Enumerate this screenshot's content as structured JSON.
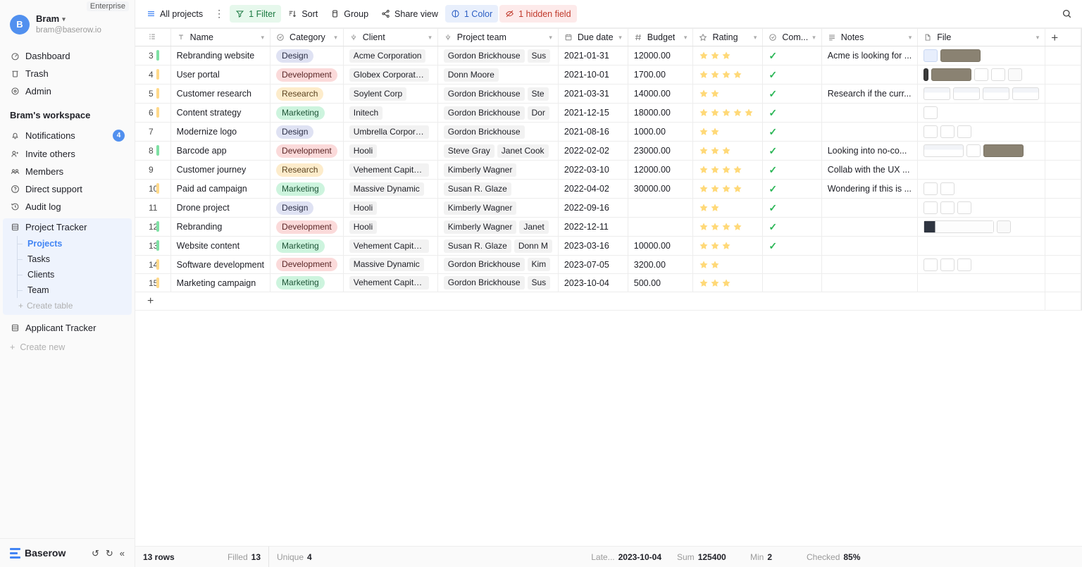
{
  "sidebar": {
    "enterprise_badge": "Enterprise",
    "user": {
      "initial": "B",
      "name": "Bram",
      "email": "bram@baserow.io"
    },
    "nav": [
      {
        "label": "Dashboard",
        "icon": "dashboard-icon"
      },
      {
        "label": "Trash",
        "icon": "trash-icon"
      },
      {
        "label": "Admin",
        "icon": "admin-gear-icon"
      }
    ],
    "workspace_title": "Bram's workspace",
    "workspace_items": [
      {
        "label": "Notifications",
        "icon": "bell-icon",
        "badge": "4"
      },
      {
        "label": "Invite others",
        "icon": "invite-user-icon",
        "badge": ""
      },
      {
        "label": "Members",
        "icon": "members-icon",
        "badge": ""
      },
      {
        "label": "Direct support",
        "icon": "question-circle-icon",
        "badge": ""
      },
      {
        "label": "Audit log",
        "icon": "history-clock-icon",
        "badge": ""
      }
    ],
    "database": {
      "name": "Project Tracker",
      "tables": [
        {
          "label": "Projects",
          "active": true
        },
        {
          "label": "Tasks",
          "active": false
        },
        {
          "label": "Clients",
          "active": false
        },
        {
          "label": "Team",
          "active": false
        }
      ],
      "create_table": "Create table"
    },
    "database2": {
      "name": "Applicant Tracker"
    },
    "create_new": "Create new",
    "footer": {
      "brand": "Baserow",
      "undo": "↺",
      "redo": "↻",
      "collapse": "«"
    }
  },
  "toolbar": {
    "view_name": "All projects",
    "dots": "⋮",
    "filter": "1 Filter",
    "sort": "Sort",
    "group": "Group",
    "share": "Share view",
    "color": "1 Color",
    "hidden_field": "1 hidden field",
    "search_icon": "search-icon"
  },
  "grid": {
    "columns": [
      {
        "key": "rownum",
        "label": "",
        "icon": "rows-icon"
      },
      {
        "key": "name",
        "label": "Name",
        "icon": "text-field-icon"
      },
      {
        "key": "category",
        "label": "Category",
        "icon": "single-select-icon"
      },
      {
        "key": "client",
        "label": "Client",
        "icon": "link-row-icon"
      },
      {
        "key": "team",
        "label": "Project team",
        "icon": "link-row-icon"
      },
      {
        "key": "due",
        "label": "Due date",
        "icon": "calendar-icon"
      },
      {
        "key": "budget",
        "label": "Budget",
        "icon": "number-icon"
      },
      {
        "key": "rating",
        "label": "Rating",
        "icon": "star-icon"
      },
      {
        "key": "com",
        "label": "Com...",
        "icon": "boolean-icon"
      },
      {
        "key": "notes",
        "label": "Notes",
        "icon": "long-text-icon"
      },
      {
        "key": "file",
        "label": "File",
        "icon": "file-icon"
      }
    ],
    "add_field_label": "+",
    "add_row_label": "+",
    "rows": [
      {
        "num": "3",
        "color": "green",
        "name": "Rebranding website",
        "category": "Design",
        "client": "Acme Corporation",
        "team": [
          "Gordon Brickhouse",
          "Sus"
        ],
        "due": "2021-01-31",
        "budget": "12000.00",
        "rating": 3,
        "completed": true,
        "notes": "Acme is looking for ...",
        "files": [
          "blue",
          "photo"
        ]
      },
      {
        "num": "4",
        "color": "yellow",
        "name": "User portal",
        "category": "Development",
        "client": "Globex Corporation",
        "team": [
          "Donn Moore"
        ],
        "due": "2021-10-01",
        "budget": "1700.00",
        "rating": 4,
        "completed": true,
        "notes": "",
        "files": [
          "dark-narrow",
          "photo",
          "icon",
          "icon",
          "white"
        ]
      },
      {
        "num": "5",
        "color": "yellow",
        "name": "Customer research",
        "category": "Research",
        "client": "Soylent Corp",
        "team": [
          "Gordon Brickhouse",
          "Ste"
        ],
        "due": "2021-03-31",
        "budget": "14000.00",
        "rating": 2,
        "completed": true,
        "notes": "Research if the curr...",
        "files": [
          "sheet",
          "sheet",
          "sheet",
          "sheet"
        ]
      },
      {
        "num": "6",
        "color": "yellow",
        "name": "Content strategy",
        "category": "Marketing",
        "client": "Initech",
        "team": [
          "Gordon Brickhouse",
          "Dor"
        ],
        "due": "2021-12-15",
        "budget": "18000.00",
        "rating": 5,
        "completed": true,
        "notes": "",
        "files": [
          "icon"
        ]
      },
      {
        "num": "7",
        "color": "",
        "name": "Modernize logo",
        "category": "Design",
        "client": "Umbrella Corporation",
        "team": [
          "Gordon Brickhouse"
        ],
        "due": "2021-08-16",
        "budget": "1000.00",
        "rating": 2,
        "completed": true,
        "notes": "",
        "files": [
          "icon",
          "icon",
          "icon"
        ]
      },
      {
        "num": "8",
        "color": "green",
        "name": "Barcode app",
        "category": "Development",
        "client": "Hooli",
        "team": [
          "Steve Gray",
          "Janet Cook"
        ],
        "due": "2022-02-02",
        "budget": "23000.00",
        "rating": 3,
        "completed": true,
        "notes": "Looking into no-co...",
        "files": [
          "sheet-wide",
          "icon",
          "photo"
        ]
      },
      {
        "num": "9",
        "color": "",
        "name": "Customer journey",
        "category": "Research",
        "client": "Vehement Capital Pa...",
        "team": [
          "Kimberly Wagner"
        ],
        "due": "2022-03-10",
        "budget": "12000.00",
        "rating": 4,
        "completed": true,
        "notes": "Collab with the UX ...",
        "files": []
      },
      {
        "num": "10",
        "color": "yellow",
        "name": "Paid ad campaign",
        "category": "Marketing",
        "client": "Massive Dynamic",
        "team": [
          "Susan R. Glaze"
        ],
        "due": "2022-04-02",
        "budget": "30000.00",
        "rating": 4,
        "completed": true,
        "notes": "Wondering if this is ...",
        "files": [
          "icon",
          "icon"
        ]
      },
      {
        "num": "11",
        "color": "",
        "name": "Drone project",
        "category": "Design",
        "client": "Hooli",
        "team": [
          "Kimberly Wagner"
        ],
        "due": "2022-09-16",
        "budget": "",
        "rating": 2,
        "completed": true,
        "notes": "",
        "files": [
          "icon",
          "icon",
          "icon"
        ]
      },
      {
        "num": "12",
        "color": "green",
        "name": "Rebranding",
        "category": "Development",
        "client": "Hooli",
        "team": [
          "Kimberly Wagner",
          "Janet"
        ],
        "due": "2022-12-11",
        "budget": "",
        "rating": 4,
        "completed": true,
        "notes": "",
        "files": [
          "screen",
          "white"
        ]
      },
      {
        "num": "13",
        "color": "green",
        "name": "Website content",
        "category": "Marketing",
        "client": "Vehement Capital Pa...",
        "team": [
          "Susan R. Glaze",
          "Donn M"
        ],
        "due": "2023-03-16",
        "budget": "10000.00",
        "rating": 3,
        "completed": true,
        "notes": "",
        "files": []
      },
      {
        "num": "14",
        "color": "yellow",
        "name": "Software development",
        "category": "Development",
        "client": "Massive Dynamic",
        "team": [
          "Gordon Brickhouse",
          "Kim"
        ],
        "due": "2023-07-05",
        "budget": "3200.00",
        "rating": 2,
        "completed": false,
        "notes": "",
        "files": [
          "icon",
          "icon",
          "icon"
        ]
      },
      {
        "num": "15",
        "color": "yellow",
        "name": "Marketing campaign",
        "category": "Marketing",
        "client": "Vehement Capital Pa...",
        "team": [
          "Gordon Brickhouse",
          "Sus"
        ],
        "due": "2023-10-04",
        "budget": "500.00",
        "rating": 3,
        "completed": false,
        "notes": "",
        "files": []
      }
    ]
  },
  "footer": {
    "row_count": "13 rows",
    "filled_label": "Filled",
    "filled_value": "13",
    "unique_label": "Unique",
    "unique_value": "4",
    "latest_label": "Late...",
    "latest_value": "2023-10-04",
    "sum_label": "Sum",
    "sum_value": "125400",
    "min_label": "Min",
    "min_value": "2",
    "checked_label": "Checked",
    "checked_value": "85%"
  },
  "colors": {
    "accent": "#4285f4",
    "row_green": "#7fe0a4",
    "row_yellow": "#ffd98a",
    "check_green": "#2bb656",
    "star": "#ffd978"
  }
}
